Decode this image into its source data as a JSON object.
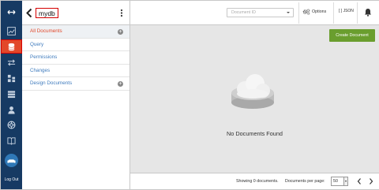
{
  "sidebar": {
    "logout_label": "Log Out",
    "active_item": "databases"
  },
  "database": {
    "name": "mydb",
    "nav_items": [
      {
        "label": "All Documents",
        "active": true,
        "has_add": true
      },
      {
        "label": "Query",
        "active": false,
        "has_add": false
      },
      {
        "label": "Permissions",
        "active": false,
        "has_add": false
      },
      {
        "label": "Changes",
        "active": false,
        "has_add": false
      },
      {
        "label": "Design Documents",
        "active": false,
        "has_add": true
      }
    ]
  },
  "toolbar": {
    "document_id_placeholder": "Document ID",
    "options_label": "Options",
    "json_label": "JSON"
  },
  "main": {
    "create_button_label": "Create Document",
    "empty_message": "No Documents Found"
  },
  "footer": {
    "showing_text": "Showing 0 documents.",
    "per_page_label": "Documents per page:",
    "per_page_value": "50"
  },
  "colors": {
    "rail_bg": "#163a63",
    "active_accent": "#e2482a",
    "link": "#3f7bbd",
    "create_button": "#6a9e2e",
    "highlight_outline": "#d40000"
  }
}
